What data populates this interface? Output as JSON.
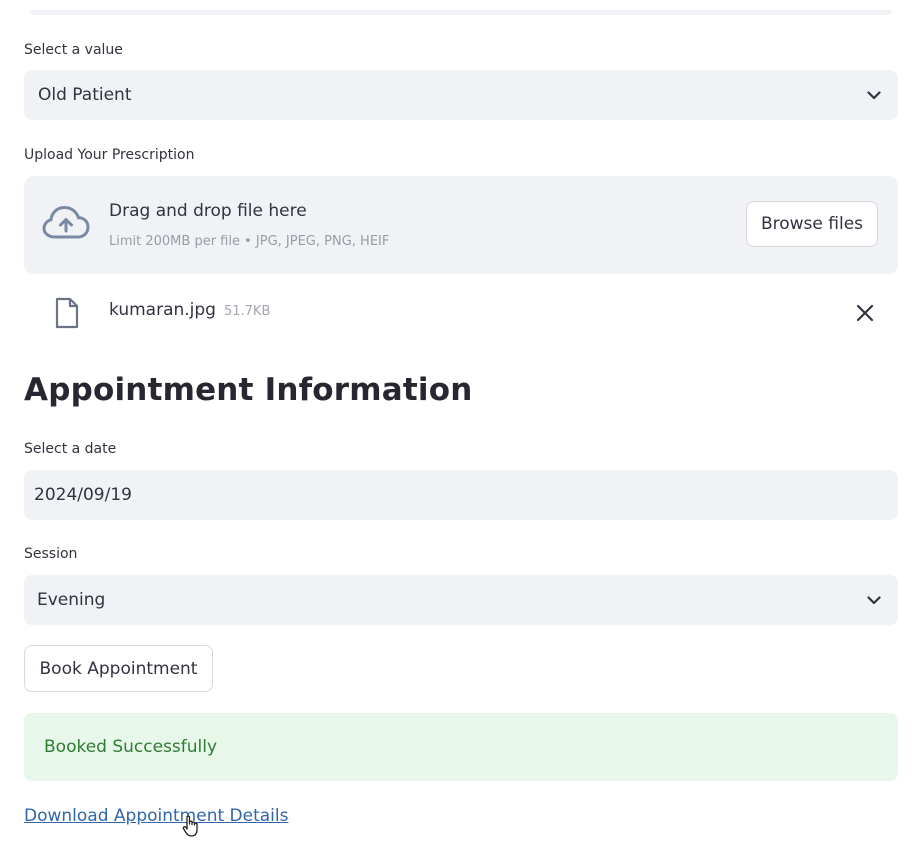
{
  "patient_type": {
    "label": "Select a value",
    "value": "Old Patient",
    "icon": "chevron-down-icon"
  },
  "prescription": {
    "label": "Upload Your Prescription",
    "dropzone_title": "Drag and drop file here",
    "dropzone_limit": "Limit 200MB per file • JPG, JPEG, PNG, HEIF",
    "browse_label": "Browse files",
    "upload_icon": "cloud-upload-icon",
    "file": {
      "name": "kumaran.jpg",
      "size": "51.7KB",
      "icon": "file-icon",
      "remove_icon": "close-icon"
    }
  },
  "appointment": {
    "heading": "Appointment Information",
    "date_label": "Select a date",
    "date_value": "2024/09/19",
    "session_label": "Session",
    "session_value": "Evening",
    "book_button": "Book Appointment",
    "success_message": "Booked Successfully",
    "download_link": "Download Appointment Details"
  },
  "colors": {
    "field_bg": "#f0f2f6",
    "success_bg": "#e7f7ea",
    "success_text": "#2f7d32",
    "link": "#3266a8"
  }
}
